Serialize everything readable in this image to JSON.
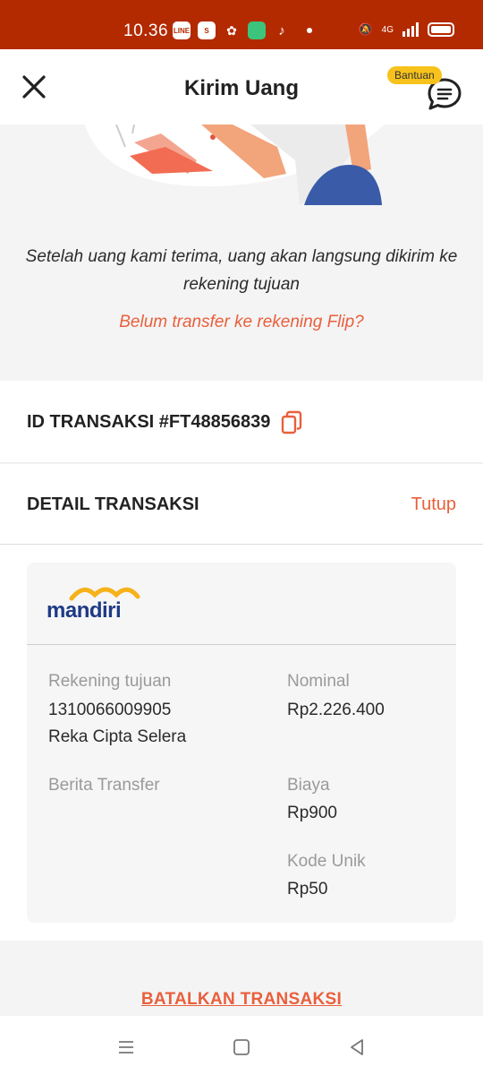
{
  "status_bar": {
    "time": "10.36",
    "app_icons": [
      "line-icon",
      "shopee-icon",
      "browser-icon",
      "chat-app-icon",
      "tiktok-icon"
    ],
    "network": "4G",
    "battery_percent": 100
  },
  "app_bar": {
    "title": "Kirim Uang",
    "help_badge": "Bantuan"
  },
  "hero": {
    "message": "Setelah uang kami terima, uang akan langsung dikirim ke rekening tujuan",
    "link": "Belum transfer ke rekening Flip?"
  },
  "transaction": {
    "id_label": "ID TRANSAKSI #FT48856839"
  },
  "detail": {
    "header": "DETAIL TRANSAKSI",
    "toggle": "Tutup",
    "bank_name": "mandiri",
    "fields": {
      "rekening_label": "Rekening tujuan",
      "rekening_number": "1310066009905",
      "rekening_name": "Reka Cipta Selera",
      "berita_label": "Berita Transfer",
      "nominal_label": "Nominal",
      "nominal_value": "Rp2.226.400",
      "biaya_label": "Biaya",
      "biaya_value": "Rp900",
      "kode_label": "Kode Unik",
      "kode_value": "Rp50"
    }
  },
  "actions": {
    "cancel": "BATALKAN TRANSAKSI"
  },
  "colors": {
    "status_bar": "#b32a00",
    "accent": "#e95f3b",
    "badge": "#f7c21b",
    "bank_blue": "#1f3a85"
  }
}
